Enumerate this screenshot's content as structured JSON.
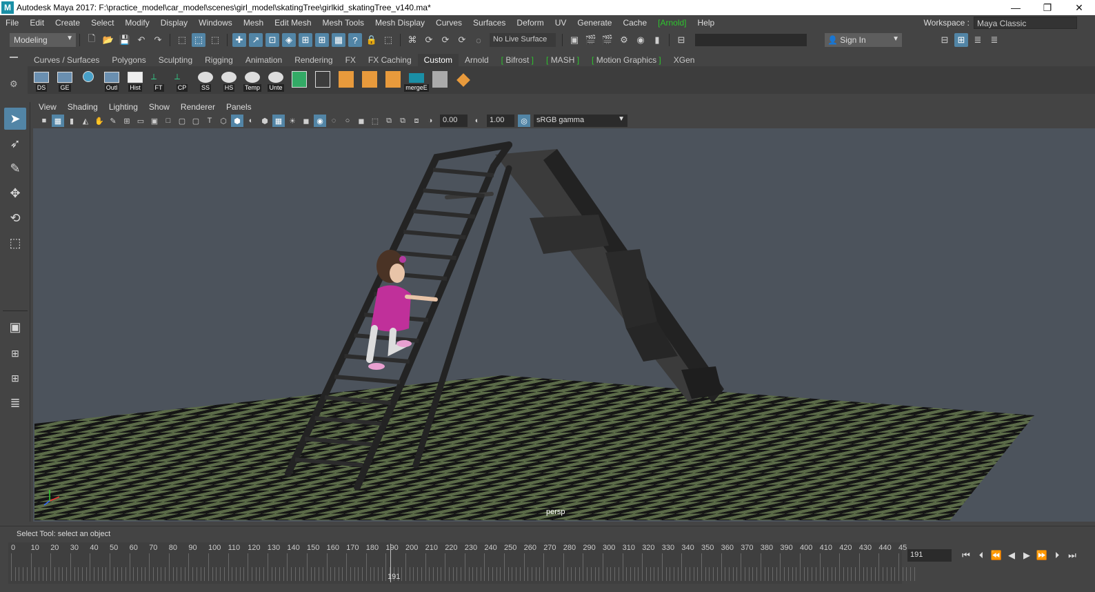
{
  "window": {
    "logo": "M",
    "title": "Autodesk Maya 2017: F:\\practice_model\\car_model\\scenes\\girl_model\\skatingTree\\girlkid_skatingTree_v140.ma*",
    "minimize": "—",
    "restore": "❐",
    "close": "✕"
  },
  "menus": [
    "File",
    "Edit",
    "Create",
    "Select",
    "Modify",
    "Display",
    "Windows",
    "Mesh",
    "Edit Mesh",
    "Mesh Tools",
    "Mesh Display",
    "Curves",
    "Surfaces",
    "Deform",
    "UV",
    "Generate",
    "Cache",
    "[Arnold]",
    "Help"
  ],
  "workspace": {
    "label": "Workspace :",
    "value": "Maya Classic"
  },
  "statusline": {
    "menuset": "Modeling",
    "live_surface": "No Live Surface",
    "sign_in": "Sign In"
  },
  "shelf": {
    "tabs": [
      "Curves / Surfaces",
      "Polygons",
      "Sculpting",
      "Rigging",
      "Animation",
      "Rendering",
      "FX",
      "FX Caching",
      "Custom",
      "Arnold",
      "Bifrost",
      "MASH",
      "Motion Graphics",
      "XGen"
    ],
    "active_tab": "Custom",
    "buttons": [
      "DS",
      "GE",
      "",
      "Outl",
      "Hist",
      "FT",
      "CP",
      "SS",
      "HS",
      "Temp",
      "Unte",
      "",
      "",
      "",
      "",
      "",
      "mergeE",
      "",
      ""
    ]
  },
  "panel": {
    "menus": [
      "View",
      "Shading",
      "Lighting",
      "Show",
      "Renderer",
      "Panels"
    ],
    "exposure": "0.00",
    "gamma": "1.00",
    "color_space": "sRGB gamma",
    "camera": "persp"
  },
  "helpline": "Select Tool: select an object",
  "timeslider": {
    "ticks": [
      "0",
      "10",
      "20",
      "30",
      "40",
      "50",
      "60",
      "70",
      "80",
      "90",
      "100",
      "110",
      "120",
      "130",
      "140",
      "150",
      "160",
      "170",
      "180",
      "190",
      "200",
      "210",
      "220",
      "230",
      "240",
      "250",
      "260",
      "270",
      "280",
      "290",
      "300",
      "310",
      "320",
      "330",
      "340",
      "350",
      "360",
      "370",
      "380",
      "390",
      "400",
      "410",
      "420",
      "430",
      "440",
      "45"
    ],
    "current_frame": "191",
    "frame_field": "191"
  },
  "colors": {
    "accent": "#5285a6",
    "viewport_bg": "#4c535c",
    "grid_green": "#5b6b48",
    "grid_dark": "#151515",
    "dress_pink": "#c0309a"
  }
}
